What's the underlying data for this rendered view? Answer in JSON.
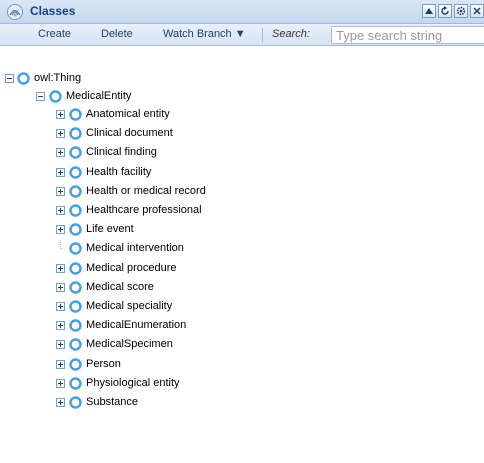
{
  "header": {
    "title": "Classes",
    "icon": "classes-network-icon",
    "tools": [
      {
        "name": "collapse-tool",
        "glyph": "▲"
      },
      {
        "name": "refresh-tool",
        "glyph": "↻"
      },
      {
        "name": "settings-tool",
        "glyph": "⚙"
      },
      {
        "name": "close-tool",
        "glyph": "✕"
      }
    ]
  },
  "toolbar": {
    "create_label": "Create",
    "delete_label": "Delete",
    "watch_branch_label": "Watch Branch ▼",
    "search_label": "Search:",
    "search_placeholder": "Type search string",
    "search_value": ""
  },
  "colors": {
    "header_bg": "#c5d8ef",
    "border": "#99bbe8",
    "title_color": "#15428b",
    "node_icon": "#4a9ee0"
  },
  "tree": {
    "root": {
      "label": "owl:Thing",
      "expanded": true
    },
    "medical_entity": {
      "label": "MedicalEntity",
      "expanded": true
    },
    "children": [
      {
        "label": "Anatomical entity",
        "has_children": true
      },
      {
        "label": "Clinical document",
        "has_children": true
      },
      {
        "label": "Clinical finding",
        "has_children": true
      },
      {
        "label": "Health facility",
        "has_children": true
      },
      {
        "label": "Health or medical record",
        "has_children": true
      },
      {
        "label": "Healthcare professional",
        "has_children": true
      },
      {
        "label": "Life event",
        "has_children": true
      },
      {
        "label": "Medical intervention",
        "has_children": false
      },
      {
        "label": "Medical procedure",
        "has_children": true
      },
      {
        "label": "Medical score",
        "has_children": true
      },
      {
        "label": "Medical speciality",
        "has_children": true
      },
      {
        "label": "MedicalEnumeration",
        "has_children": true
      },
      {
        "label": "MedicalSpecimen",
        "has_children": true
      },
      {
        "label": "Person",
        "has_children": true
      },
      {
        "label": "Physiological entity",
        "has_children": true
      },
      {
        "label": "Substance",
        "has_children": true
      }
    ]
  }
}
